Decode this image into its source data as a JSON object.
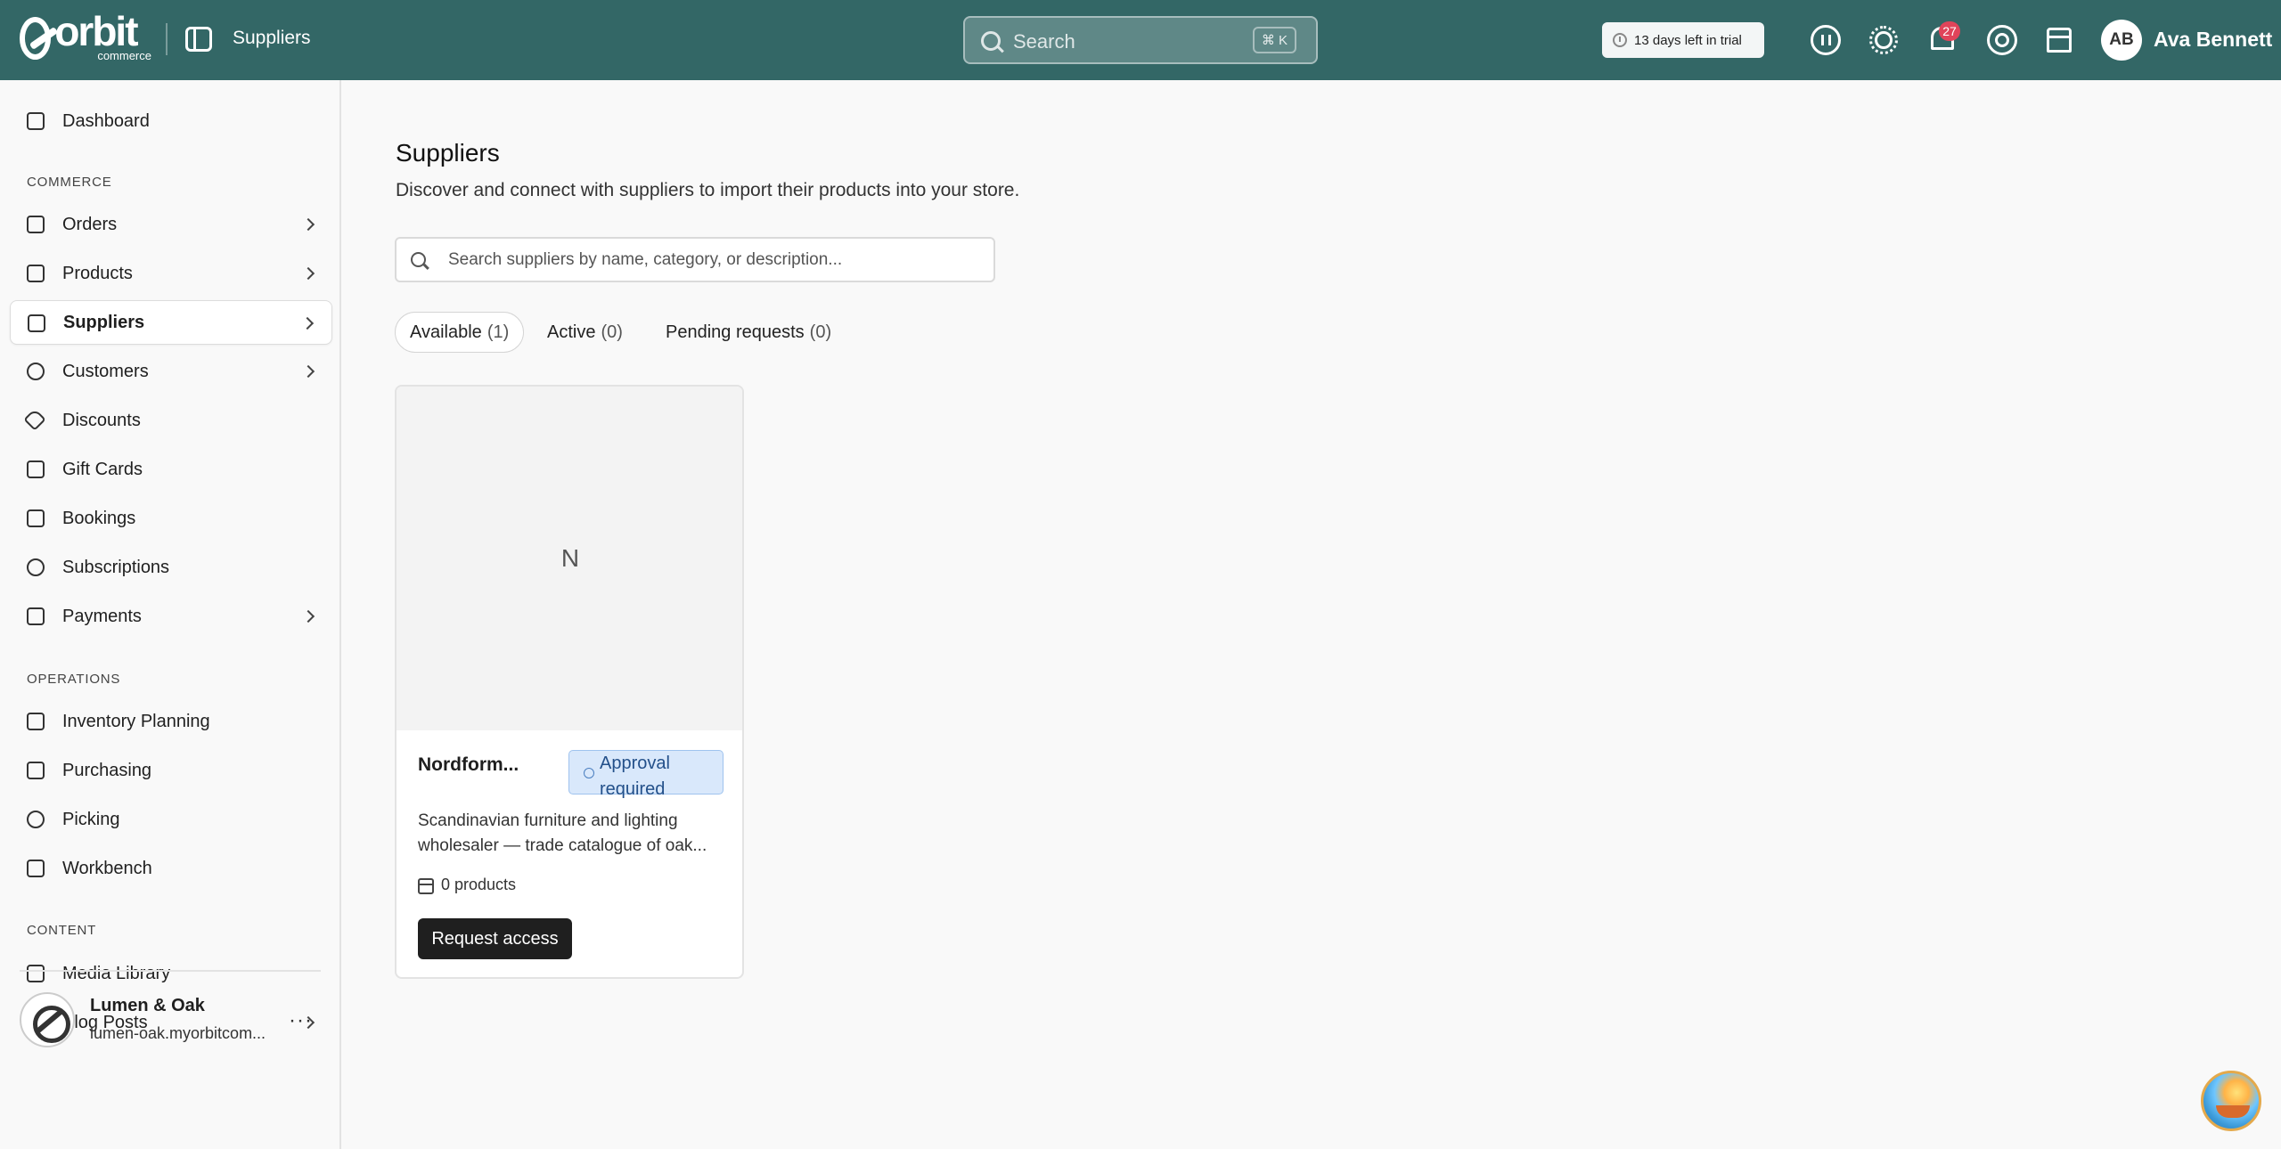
{
  "topbar": {
    "logo_word": "orbit",
    "logo_sub": "commerce",
    "title": "Suppliers",
    "search_placeholder": "Search",
    "search_shortcut": "⌘ K",
    "trial_text": "13 days left in trial",
    "notification_count": "27",
    "user_initials": "AB",
    "user_name": "Ava Bennett"
  },
  "sidebar": {
    "dashboard": "Dashboard",
    "section_commerce": "COMMERCE",
    "orders": "Orders",
    "products": "Products",
    "suppliers": "Suppliers",
    "customers": "Customers",
    "discounts": "Discounts",
    "gift_cards": "Gift Cards",
    "bookings": "Bookings",
    "subscriptions": "Subscriptions",
    "payments": "Payments",
    "section_operations": "OPERATIONS",
    "inventory_planning": "Inventory Planning",
    "purchasing": "Purchasing",
    "picking": "Picking",
    "workbench": "Workbench",
    "section_content": "CONTENT",
    "media_library": "Media Library",
    "blog_posts": "Blog Posts",
    "store_name": "Lumen & Oak",
    "store_url": "lumen-oak.myorbitcom...",
    "more": "···"
  },
  "main": {
    "title": "Suppliers",
    "description": "Discover and connect with suppliers to import their products into your store.",
    "search_placeholder": "Search suppliers by name, category, or description...",
    "tabs": [
      {
        "label": "Available",
        "count": "(1)"
      },
      {
        "label": "Active",
        "count": "(0)"
      },
      {
        "label": "Pending requests",
        "count": "(0)"
      }
    ],
    "card": {
      "initial": "N",
      "name": "Nordform...",
      "badge": "Approval required",
      "description_line1": "Scandinavian furniture and lighting",
      "description_line2": "wholesaler — trade catalogue of oak...",
      "products": "0 products",
      "button": "Request access"
    }
  },
  "colors": {
    "topbar": "#336766",
    "badge_bg": "#d9e8fb",
    "badge_text": "#23508a",
    "notification": "#e0445a"
  }
}
